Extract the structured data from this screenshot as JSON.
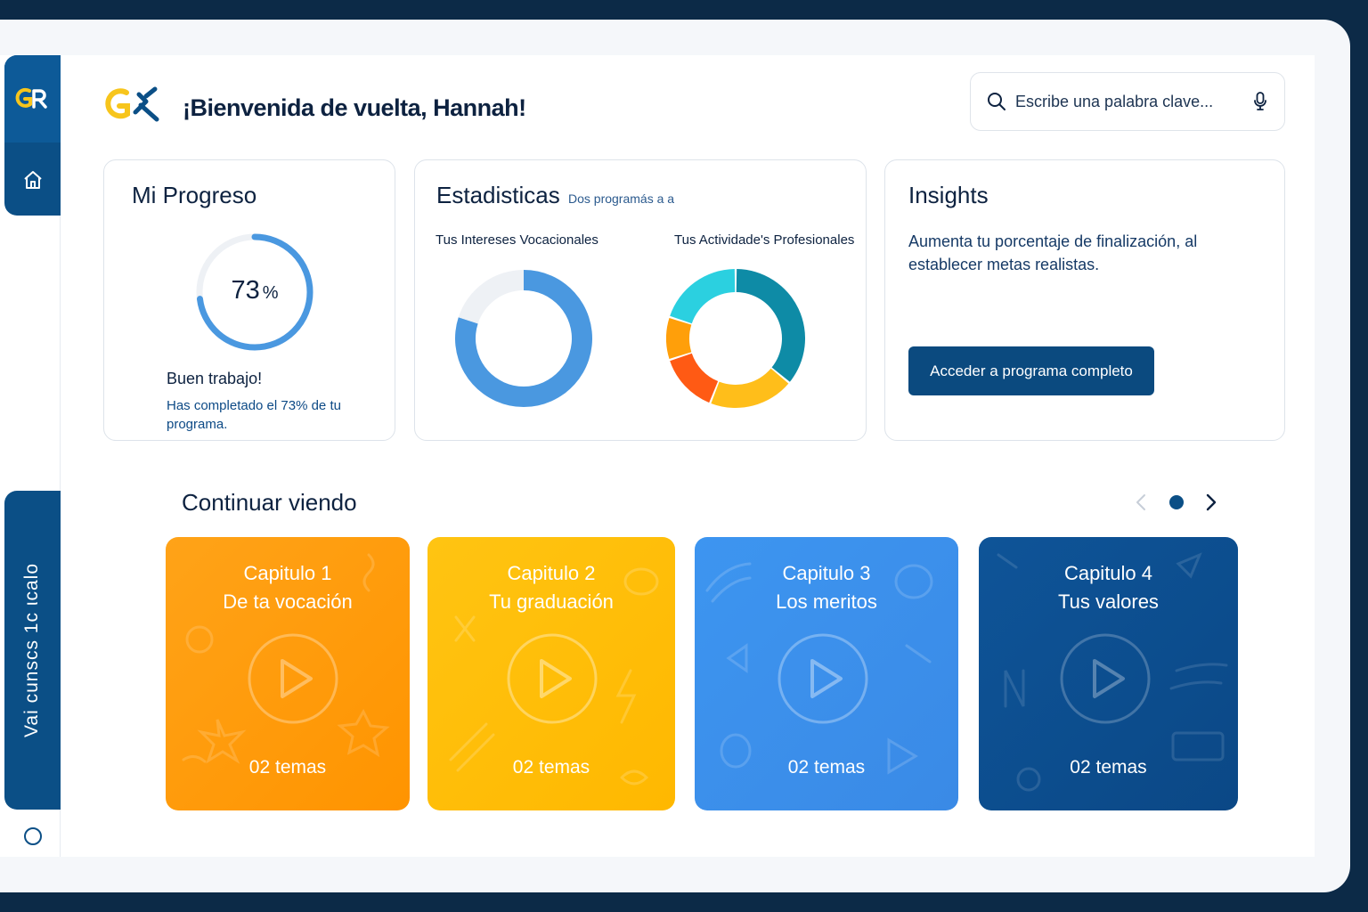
{
  "header": {
    "welcome": "¡Bienvenida de vuelta, Hannah!",
    "logo_text": "GR"
  },
  "search": {
    "placeholder": "Escribe una palabra clave..."
  },
  "sidebar": {
    "vertical_label": "Vai cunscs 1c ιcalo"
  },
  "progress": {
    "title": "Mi Progreso",
    "value": 73,
    "value_label": "73",
    "unit": "%",
    "headline": "Buen trabajo!",
    "description": "Has completado el 73% de tu programa."
  },
  "stats": {
    "title": "Estadisticas",
    "subtitle": "Dos programás a a",
    "chart1_label": "Tus Intereses Vocacionales",
    "chart2_label": "Tus Actividade's Profesionales"
  },
  "chart_data": [
    {
      "type": "pie",
      "title": "Tus Intereses Vocacionales",
      "values": [
        80,
        20
      ],
      "colors": [
        "#4a98e0",
        "#eef1f5"
      ]
    },
    {
      "type": "pie",
      "title": "Tus Actividade's Profesionales",
      "values": [
        36,
        20,
        14,
        10,
        20
      ],
      "colors": [
        "#0e8ba6",
        "#ffbe1a",
        "#ff5a14",
        "#ff9f0a",
        "#2bd0e0"
      ]
    }
  ],
  "insights": {
    "title": "Insights",
    "text": "Aumenta tu porcentaje de finalización, al establecer metas realistas.",
    "button": "Acceder a programa completo"
  },
  "continue": {
    "title": "Continuar viendo",
    "chapters": [
      {
        "title": "Capitulo 1",
        "subtitle": "De ta vocación",
        "topics": "02 temas"
      },
      {
        "title": "Capitulo 2",
        "subtitle": "Tu graduación",
        "topics": "02 temas"
      },
      {
        "title": "Capitulo 3",
        "subtitle": "Los meritos",
        "topics": "02 temas"
      },
      {
        "title": "Capitulo 4",
        "subtitle": "Tus valores",
        "topics": "02 temas"
      }
    ]
  },
  "colors": {
    "navy": "#0b4f86",
    "accent_yellow": "#f7c51c",
    "progress_blue": "#4a98e0"
  }
}
